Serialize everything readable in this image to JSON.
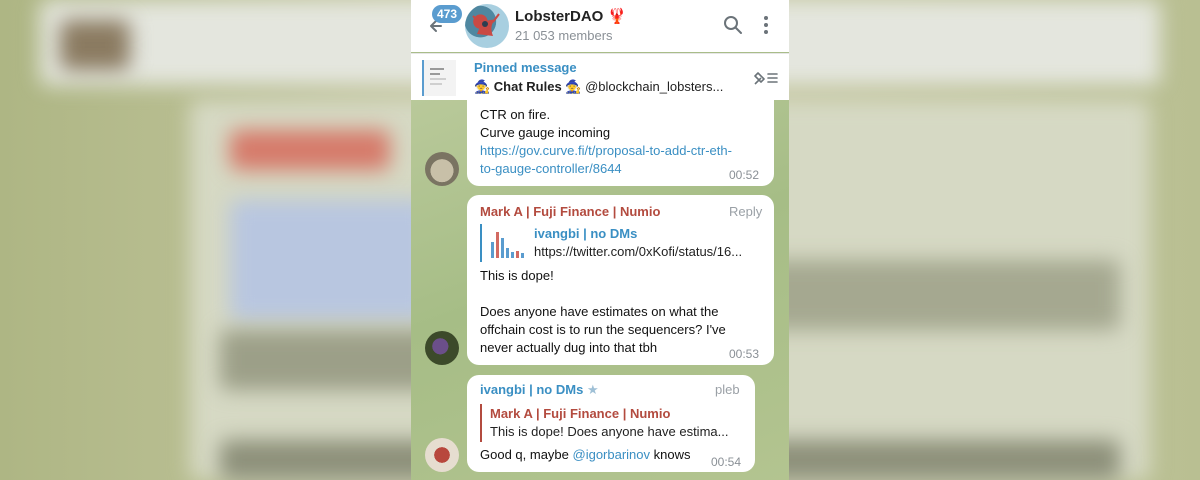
{
  "header": {
    "unread_badge": "473",
    "title": "LobsterDAO 🦞",
    "members": "21 053 members"
  },
  "pinned": {
    "label": "Pinned message",
    "text_bold": "🧙 Chat Rules 🧙",
    "text_rest": " @blockchain_lobsters..."
  },
  "messages": [
    {
      "line1": "CTR on fire.",
      "line2": "Curve gauge incoming",
      "link_line1": "https://gov.curve.fi/t/proposal-to-add-ctr-eth-",
      "link_line2": "to-gauge-controller/8644",
      "time": "00:52"
    },
    {
      "sender": "Mark A | Fuji Finance | Numio",
      "reply_label": "Reply",
      "quote_name": "ivangbi | no DMs",
      "quote_text": "https://twitter.com/0xKofi/status/16...",
      "line1": "This is dope!",
      "line2": "Does anyone have estimates on what the",
      "line3": "offchain cost is to run the sequencers? I've",
      "line4": "never actually dug into that tbh",
      "time": "00:53"
    },
    {
      "sender": "ivangbi | no DMs",
      "sender_star": "★",
      "role": "pleb",
      "quote_name": "Mark A | Fuji Finance | Numio",
      "quote_text": "This is dope!   Does anyone have estima...",
      "text_before": "Good q, maybe ",
      "mention": "@igorbarinov",
      "text_after": " knows",
      "time": "00:54"
    }
  ],
  "colors": {
    "accent": "#3a8fc3",
    "mark_name": "#b34b3f",
    "ivan_name": "#3a8fc3",
    "badge": "#5a9ccf"
  }
}
